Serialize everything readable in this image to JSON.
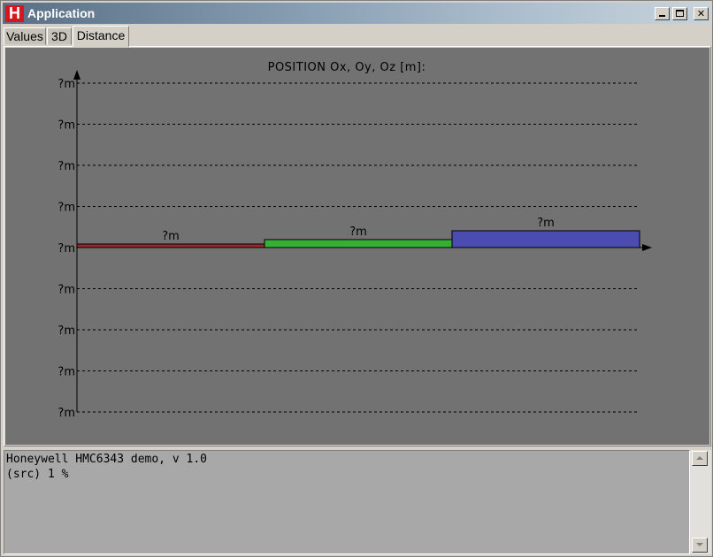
{
  "window": {
    "title": "Application",
    "icon_letter": "H",
    "icon_color": "#d6161f"
  },
  "tabs": [
    {
      "label": "Values",
      "active": false
    },
    {
      "label": "3D",
      "active": false
    },
    {
      "label": "Distance",
      "active": true
    }
  ],
  "plot": {
    "title": "POSITION Ox, Oy, Oz [m]:",
    "background": "#727272",
    "y_tick_labels": [
      "?m",
      "?m",
      "?m",
      "?m",
      "?m",
      "?m",
      "?m",
      "?m",
      "?m"
    ],
    "bars": [
      {
        "axis": "Ox",
        "label": "?m",
        "color": "#9a2a2a"
      },
      {
        "axis": "Oy",
        "label": "?m",
        "color": "#34b034"
      },
      {
        "axis": "Oz",
        "label": "?m",
        "color": "#4a4cb0"
      }
    ]
  },
  "console": {
    "lines": [
      "Honeywell HMC6343 demo, v 1.0",
      "(src) 1 %"
    ]
  }
}
